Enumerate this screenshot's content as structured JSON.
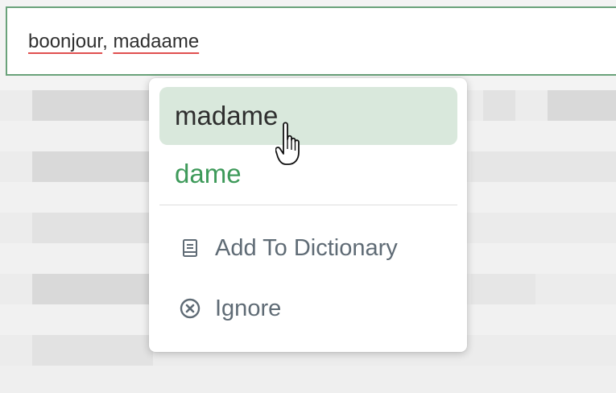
{
  "input": {
    "word1": "boonjour",
    "separator": ", ",
    "word2": "madaame"
  },
  "spellcheck_menu": {
    "suggestions": [
      {
        "label": "madame",
        "state": "hovered"
      },
      {
        "label": "dame",
        "state": "normal"
      }
    ],
    "actions": {
      "add_to_dictionary": {
        "label": "Add To Dictionary",
        "icon": "book-icon"
      },
      "ignore": {
        "label": "Ignore",
        "icon": "close-circle-icon"
      }
    }
  },
  "colors": {
    "input_border": "#6aa27a",
    "misspelling_underline": "#e05050",
    "suggestion_text": "#3e9a5a",
    "hover_background": "#d9e8dc",
    "action_text": "#5f6b75"
  }
}
